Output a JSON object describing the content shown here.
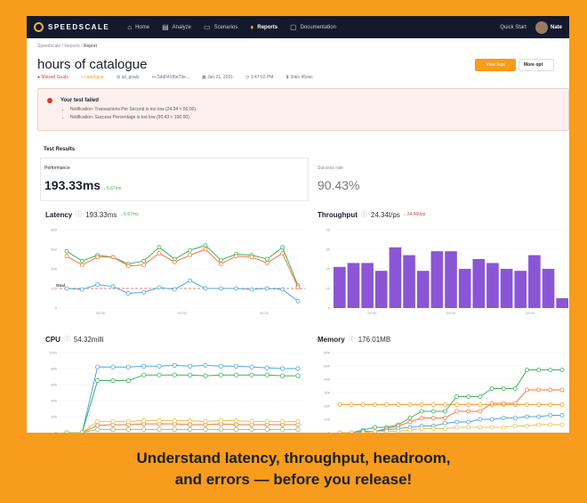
{
  "nav": {
    "brand": "SPEEDSCALE",
    "items": [
      {
        "label": "Home",
        "icon": "home-icon",
        "glyph": "⌂"
      },
      {
        "label": "Analyze",
        "icon": "analyze-icon",
        "glyph": "▤"
      },
      {
        "label": "Scenarios",
        "icon": "scenarios-icon",
        "glyph": "▭"
      },
      {
        "label": "Reports",
        "icon": "reports-icon",
        "glyph": "♦"
      },
      {
        "label": "Documentation",
        "icon": "documentation-icon",
        "glyph": "▢"
      }
    ],
    "quick_start": "Quick Start",
    "user": "Nate"
  },
  "breadcrumb": {
    "part1": "Speedscale",
    "sep1": "/",
    "part2": "Reports",
    "sep2": "/",
    "part3": "Report"
  },
  "report": {
    "title": "hours of catalogue",
    "status": "Missed Goals",
    "service": "catalogue",
    "goals": "all_goals",
    "id": "5dd641f8e79e...",
    "date": "Jan 21, 2021",
    "time": "3:47:02 PM",
    "duration": "3min 45sec"
  },
  "actions": {
    "view_logs": "View logs",
    "more": "More opt"
  },
  "alert": {
    "title": "Your test failed",
    "lines": [
      "Notification: Transactions Per Second is too low (24.34 < 50.00).",
      "Notification: Success Percentage is too low (90.43 < 100.00)."
    ]
  },
  "results": {
    "section_title": "Test Results",
    "performance_label": "Performance",
    "performance_value": "193.33ms",
    "performance_delta": "↓ 6.67ms",
    "success_label": "Success rate",
    "success_value": "90.43%"
  },
  "latency": {
    "title": "Latency",
    "value": "193.33ms",
    "delta": "↓ 6.67ms",
    "goal_label": "Goal",
    "chart_data": {
      "type": "line",
      "y_ticks": [
        "800",
        "600",
        "400",
        "200",
        "0"
      ],
      "ylim": [
        0,
        800
      ],
      "x_ticks": [
        "00:00",
        "00:00",
        "00:00"
      ],
      "goal": 200,
      "series": [
        {
          "color": "#41b05a",
          "values": [
            580,
            480,
            540,
            520,
            450,
            480,
            620,
            500,
            590,
            640,
            490,
            550,
            540,
            500,
            620,
            230
          ]
        },
        {
          "color": "#f07a3a",
          "values": [
            530,
            440,
            520,
            520,
            430,
            440,
            560,
            470,
            540,
            600,
            450,
            530,
            520,
            460,
            560,
            210
          ]
        },
        {
          "color": "#4ea7e0",
          "values": [
            200,
            190,
            240,
            220,
            150,
            160,
            210,
            190,
            280,
            200,
            200,
            200,
            190,
            200,
            190,
            70
          ]
        }
      ]
    }
  },
  "throughput": {
    "title": "Throughput",
    "value": "24.34t/ps",
    "delta": "↓ 24.66t/ps",
    "chart_data": {
      "type": "bar",
      "y_ticks": [
        "40",
        "30",
        "20",
        "10",
        "0"
      ],
      "ylim": [
        0,
        40
      ],
      "x_ticks": [
        "00:00",
        "00:00",
        "00:00"
      ],
      "color": "#8a56d6",
      "values": [
        21,
        23,
        23,
        19,
        31,
        27,
        19,
        29,
        29,
        20,
        25,
        23,
        20,
        19,
        27,
        20,
        5
      ]
    }
  },
  "cpu": {
    "title": "CPU",
    "value": "54.32milli",
    "chart_data": {
      "type": "line",
      "y_ticks": [
        "1000",
        "800",
        "600",
        "400",
        "200",
        "0"
      ],
      "ylim": [
        0,
        1000
      ],
      "series": [
        {
          "color": "#4ea7e0",
          "values": [
            0,
            0,
            820,
            820,
            820,
            830,
            830,
            840,
            830,
            840,
            830,
            830,
            820,
            810,
            800,
            800
          ]
        },
        {
          "color": "#41b05a",
          "values": [
            0,
            0,
            650,
            650,
            650,
            720,
            720,
            720,
            720,
            710,
            720,
            720,
            720,
            720,
            710,
            710
          ]
        },
        {
          "color": "#f07a3a",
          "values": [
            0,
            0,
            90,
            100,
            100,
            110,
            110,
            110,
            100,
            100,
            110,
            100,
            100,
            100,
            100,
            100
          ]
        },
        {
          "color": "#e8c44a",
          "values": [
            0,
            0,
            140,
            140,
            140,
            150,
            150,
            150,
            150,
            140,
            150,
            150,
            140,
            140,
            140,
            140
          ]
        },
        {
          "color": "#8bc77a",
          "values": [
            0,
            0,
            40,
            40,
            40,
            40,
            40,
            40,
            40,
            40,
            40,
            40,
            40,
            40,
            40,
            40
          ]
        }
      ]
    }
  },
  "memory": {
    "title": "Memory",
    "value": "176.01MB",
    "chart_data": {
      "type": "line",
      "y_ticks": [
        "600",
        "500",
        "400",
        "300",
        "200",
        "100",
        "0"
      ],
      "ylim": [
        0,
        600
      ],
      "series": [
        {
          "color": "#f0a029",
          "values": [
            210,
            210,
            210,
            210,
            210,
            210,
            210,
            210,
            210,
            210,
            210,
            210,
            210,
            210,
            210,
            210,
            210,
            210,
            210,
            210
          ]
        },
        {
          "color": "#41b05a",
          "values": [
            0,
            0,
            20,
            40,
            40,
            60,
            110,
            160,
            160,
            160,
            270,
            270,
            270,
            330,
            330,
            330,
            470,
            470,
            470,
            470
          ]
        },
        {
          "color": "#f07a3a",
          "values": [
            0,
            0,
            10,
            10,
            30,
            50,
            80,
            110,
            110,
            110,
            160,
            160,
            160,
            220,
            220,
            220,
            320,
            320,
            320,
            320
          ]
        },
        {
          "color": "#4ea7e0",
          "values": [
            0,
            0,
            10,
            10,
            20,
            30,
            40,
            50,
            50,
            70,
            80,
            80,
            100,
            100,
            110,
            110,
            120,
            120,
            130,
            130
          ]
        },
        {
          "color": "#e8c44a",
          "values": [
            0,
            0,
            0,
            10,
            10,
            10,
            20,
            30,
            30,
            30,
            40,
            40,
            40,
            40,
            40,
            50,
            50,
            60,
            60,
            60
          ]
        }
      ]
    }
  },
  "caption": {
    "line1": "Understand latency, throughput, headroom,",
    "line2": "and errors — before you release!"
  }
}
